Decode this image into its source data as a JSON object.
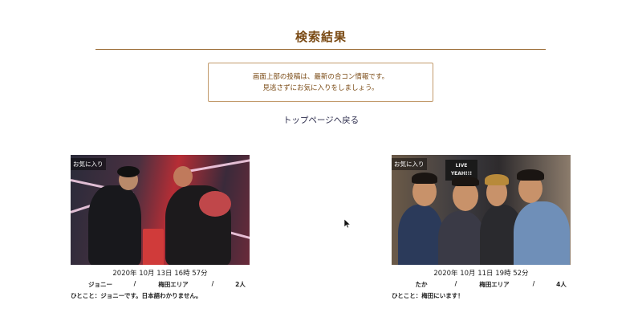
{
  "page": {
    "title": "検索結果",
    "notice": {
      "line1": "画面上部の投稿は、最新の合コン情報です。",
      "line2": "見逃さずにお気に入りをしましょう。"
    },
    "back_link": "トップページへ戻る"
  },
  "posts": [
    {
      "fav_label": "お気に入り",
      "date": "2020年 10月 13日 16時 57分",
      "name": "ジョニー",
      "sep1": "/",
      "area": "梅田エリア",
      "sep2": "/",
      "count": "2人",
      "comment": "ひとこと：ジョニーです。日本語わかりません。"
    },
    {
      "fav_label": "お気に入り",
      "sign_line1": "LIVE",
      "sign_line2": "YEAH!!!",
      "date": "2020年 10月 11日 19時 52分",
      "name": "たか",
      "sep1": "/",
      "area": "梅田エリア",
      "sep2": "/",
      "count": "4人",
      "comment": "ひとこと：梅田にいます！"
    }
  ],
  "colors": {
    "title": "#7a4a14",
    "rule": "#9a6a33",
    "notice_border": "#c29a6b",
    "link": "#2a2a4a"
  },
  "icons": {
    "cursor": "mouse-pointer-icon"
  }
}
